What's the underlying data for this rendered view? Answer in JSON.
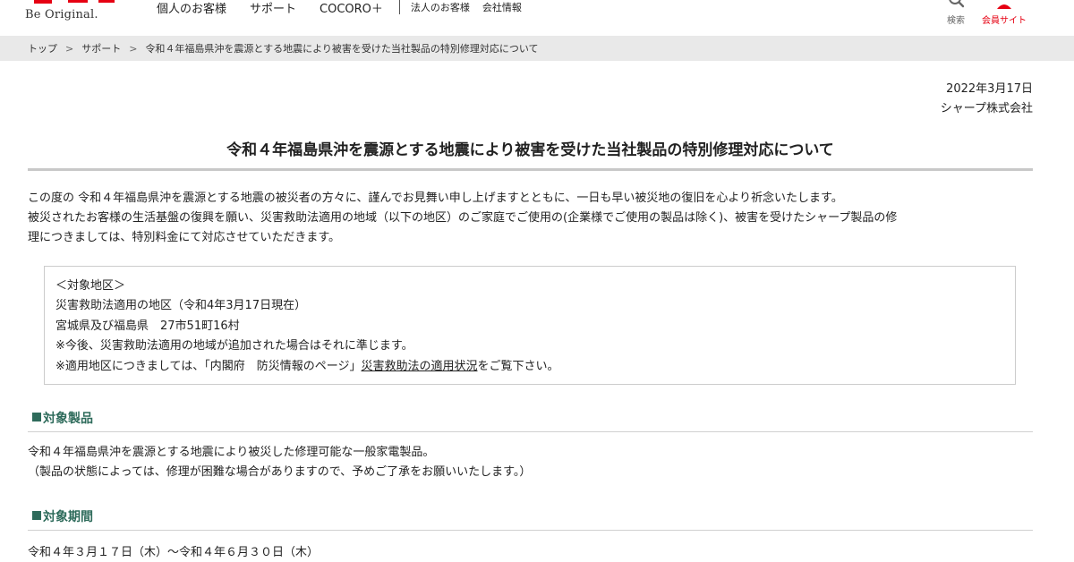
{
  "header": {
    "tagline": "Be Original.",
    "nav": [
      "個人のお客様",
      "サポート",
      "COCORO＋"
    ],
    "nav_sub": [
      "法人のお客様",
      "会社情報"
    ],
    "search_label": "検索",
    "member_label": "会員サイト"
  },
  "breadcrumb": [
    "トップ",
    "サポート",
    "令和４年福島県沖を震源とする地震により被害を受けた当社製品の特別修理対応について"
  ],
  "breadcrumb_sep": ">",
  "meta": {
    "date": "2022年3月17日",
    "company": "シャープ株式会社"
  },
  "title": "令和４年福島県沖を震源とする地震により被害を受けた当社製品の特別修理対応について",
  "intro": [
    "この度の 令和４年福島県沖を震源とする地震の被災者の方々に、謹んでお見舞い申し上げますとともに、一日も早い被災地の復旧を心より祈念いたします。",
    "被災されたお客様の生活基盤の復興を願い、災害救助法適用の地域（以下の地区）のご家庭でご使用の(企業様でご使用の製品は除く)、被害を受けたシャープ製品の修",
    "理につきましては、特別料金にて対応させていただきます。"
  ],
  "region_box": {
    "heading": "＜対象地区＞",
    "line1": "災害救助法適用の地区（令和4年3月17日現在）",
    "line2": "宮城県及び福島県　27市51町16村",
    "line3": "※今後、災害救助法適用の地域が追加された場合はそれに準じます。",
    "line4_pre": "※適用地区につきましては、「内閣府　防災情報のページ」",
    "line4_link": "災害救助法の適用状況",
    "line4_post": "をご覧下さい。"
  },
  "sections": {
    "products": {
      "heading": "対象製品",
      "lines": [
        "令和４年福島県沖を震源とする地震により被災した修理可能な一般家電製品。",
        "（製品の状態によっては、修理が困難な場合がありますので、予めご了承をお願いいたします。）"
      ]
    },
    "period": {
      "heading": "対象期間",
      "lines": [
        "令和４年３月１７日（木）～令和４年６月３０日（木）"
      ]
    }
  },
  "colors": {
    "brand_red": "#e60012",
    "section_green": "#2e6b5b",
    "breadcrumb_bg": "#e9e9e9"
  },
  "icons": {
    "search": "search-icon",
    "member": "user-icon"
  }
}
